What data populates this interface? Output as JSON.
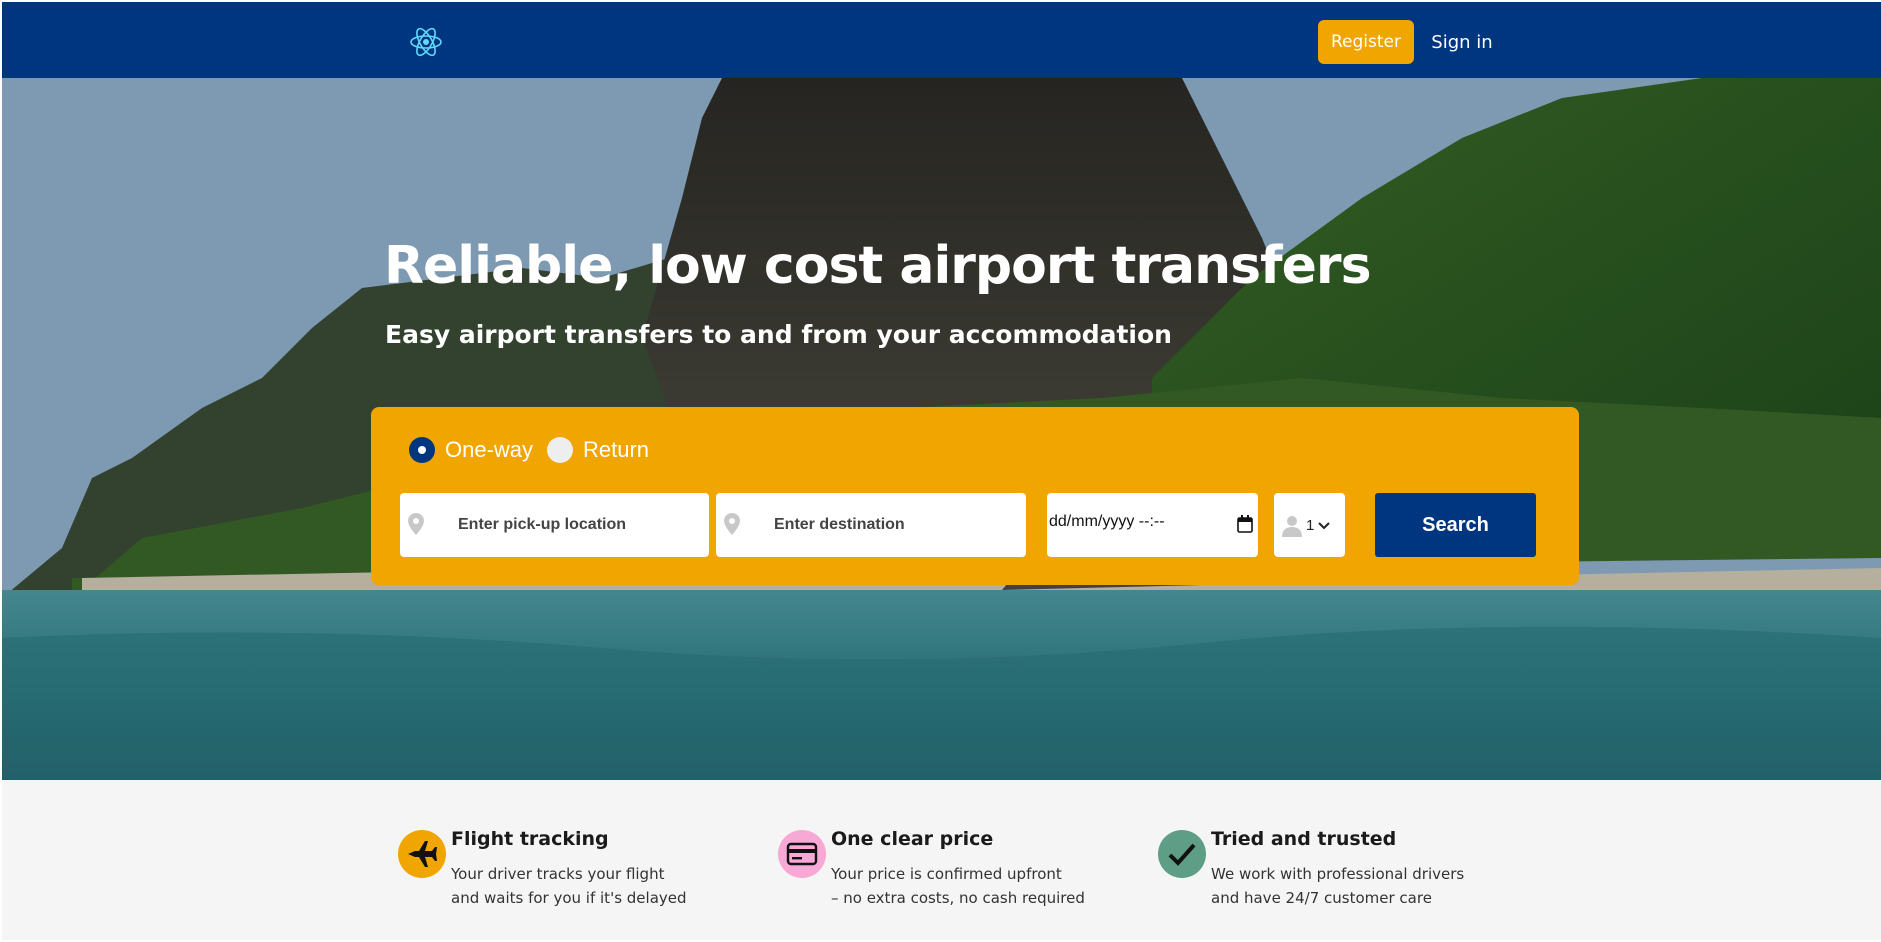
{
  "navbar": {
    "logo_icon": "react-atom-icon",
    "register_label": "Register",
    "signin_label": "Sign in",
    "background": "#003580"
  },
  "hero": {
    "title": "Reliable, low cost airport transfers",
    "subtitle": "Easy airport transfers to and from your accommodation",
    "background_image": "tropical beach with cliffs and turquoise sea"
  },
  "search": {
    "trip_types": [
      {
        "label": "One-way",
        "selected": true
      },
      {
        "label": "Return",
        "selected": false
      }
    ],
    "pickup_placeholder": "Enter pick-up location",
    "destination_placeholder": "Enter destination",
    "date_placeholder": "dd/mm/yyyy --:--",
    "passengers_value": "1",
    "search_label": "Search",
    "panel_color": "#f0a500"
  },
  "features": [
    {
      "icon": "airplane-icon",
      "icon_bg": "#f0a500",
      "title": "Flight tracking",
      "lines": [
        "Your driver tracks your flight",
        "and waits for you if it's delayed"
      ]
    },
    {
      "icon": "credit-card-icon",
      "icon_bg": "#f7a8d4",
      "title": "One clear price",
      "lines": [
        "Your price is confirmed upfront",
        "– no extra costs, no cash required"
      ]
    },
    {
      "icon": "checkmark-icon",
      "icon_bg": "#5f9e86",
      "title": "Tried and trusted",
      "lines": [
        "We work with professional drivers",
        "and have 24/7 customer care"
      ]
    }
  ]
}
